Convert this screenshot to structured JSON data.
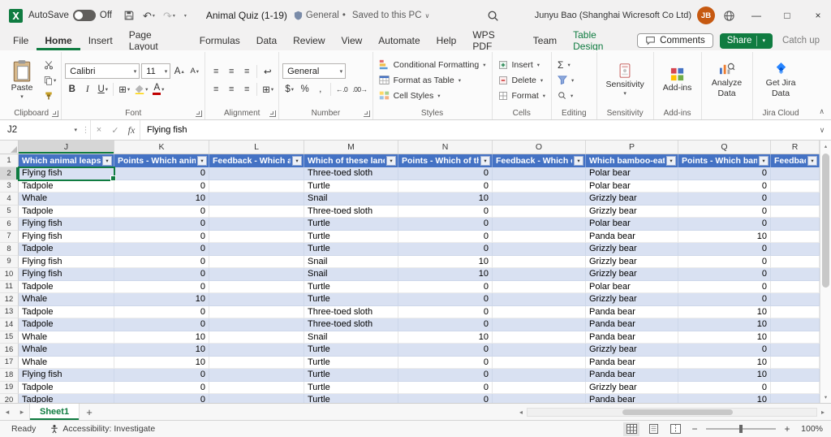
{
  "colors": {
    "accent": "#107C41",
    "table_header_fill": "#4472C4",
    "band_fill": "#D9E1F2",
    "selection_border": "#107C41",
    "avatar_fill": "#C65911",
    "jira_blue": "#2684FF"
  },
  "glyphs": {
    "dropdown": "▾",
    "undo": "↶",
    "redo": "↷",
    "bold": "B",
    "italic": "I",
    "underline": "U",
    "letter_a": "A",
    "up_tri": "▴",
    "down_tri": "▾",
    "sum": "Σ",
    "dollar": "$",
    "percent": "%",
    "comma": ",",
    "borders": "⊞",
    "merge": "⊞",
    "minimize": "—",
    "maximize": "□",
    "close": "×",
    "cancel": "×",
    "check": "✓",
    "fx": "fx",
    "more_vertical": "⋮",
    "chevron_up": "∧",
    "chevron_down": "∨",
    "tri_left": "◂",
    "tri_right": "▸",
    "plus": "+",
    "bullet": "•",
    "align_lines": "≡",
    "wrap": "↩",
    "increase_decimal": "←.0",
    "decrease_decimal": ".00→",
    "minus": "−"
  },
  "title_bar": {
    "autosave_label": "AutoSave",
    "autosave_state": "Off",
    "doc_title": "Animal Quiz (1-19)",
    "sensitivity_label": "General",
    "saved_status": "Saved to this PC",
    "user_name": "Junyu Bao (Shanghai Wicresoft Co Ltd)",
    "avatar_initials": "JB"
  },
  "tabs": {
    "items": [
      "File",
      "Home",
      "Insert",
      "Page Layout",
      "Formulas",
      "Data",
      "Review",
      "View",
      "Automate",
      "Help",
      "WPS PDF",
      "Team",
      "Table Design"
    ],
    "active": "Home",
    "contextual": "Table Design",
    "comments_label": "Comments",
    "share_label": "Share",
    "catch_up_label": "Catch up"
  },
  "ribbon": {
    "paste_label": "Paste",
    "font_name": "Calibri",
    "font_size": "11",
    "number_format": "General",
    "conditional_formatting_label": "Conditional Formatting",
    "format_as_table_label": "Format as Table",
    "cell_styles_label": "Cell Styles",
    "insert_label": "Insert",
    "delete_label": "Delete",
    "format_label": "Format",
    "sensitivity_label": "Sensitivity",
    "addins_label": "Add-ins",
    "analyze_data_label": "Analyze Data",
    "get_jira_label": "Get Jira Data",
    "group_labels": {
      "clipboard": "Clipboard",
      "font": "Font",
      "alignment": "Alignment",
      "number": "Number",
      "styles": "Styles",
      "cells": "Cells",
      "editing": "Editing",
      "sensitivity": "Sensitivity",
      "addins": "Add-ins",
      "jira": "Jira Cloud"
    }
  },
  "formula_bar": {
    "name_box": "J2",
    "value": "Flying fish"
  },
  "sheet": {
    "selected_cell": "J2",
    "active_column": "J",
    "active_row": 2,
    "column_letters": [
      "J",
      "K",
      "L",
      "M",
      "N",
      "O",
      "P",
      "Q",
      "R"
    ],
    "header_row": [
      "Which animal leaps o",
      "Points - Which anima",
      "Feedback - Which an",
      "Which of these land",
      "Points - Which of the",
      "Feedback - Which of",
      "Which bamboo-eatin",
      "Points - Which bamb",
      "Feedback"
    ],
    "rows": [
      {
        "n": 2,
        "cells": [
          "Flying fish",
          "0",
          "",
          "Three-toed sloth",
          "0",
          "",
          "Polar bear",
          "0",
          ""
        ]
      },
      {
        "n": 3,
        "cells": [
          "Tadpole",
          "0",
          "",
          "Turtle",
          "0",
          "",
          "Polar bear",
          "0",
          ""
        ]
      },
      {
        "n": 4,
        "cells": [
          "Whale",
          "10",
          "",
          "Snail",
          "10",
          "",
          "Grizzly bear",
          "0",
          ""
        ]
      },
      {
        "n": 5,
        "cells": [
          "Tadpole",
          "0",
          "",
          "Three-toed sloth",
          "0",
          "",
          "Grizzly bear",
          "0",
          ""
        ]
      },
      {
        "n": 6,
        "cells": [
          "Flying fish",
          "0",
          "",
          "Turtle",
          "0",
          "",
          "Polar bear",
          "0",
          ""
        ]
      },
      {
        "n": 7,
        "cells": [
          "Flying fish",
          "0",
          "",
          "Turtle",
          "0",
          "",
          "Panda bear",
          "10",
          ""
        ]
      },
      {
        "n": 8,
        "cells": [
          "Tadpole",
          "0",
          "",
          "Turtle",
          "0",
          "",
          "Grizzly bear",
          "0",
          ""
        ]
      },
      {
        "n": 9,
        "cells": [
          "Flying fish",
          "0",
          "",
          "Snail",
          "10",
          "",
          "Grizzly bear",
          "0",
          ""
        ]
      },
      {
        "n": 10,
        "cells": [
          "Flying fish",
          "0",
          "",
          "Snail",
          "10",
          "",
          "Grizzly bear",
          "0",
          ""
        ]
      },
      {
        "n": 11,
        "cells": [
          "Tadpole",
          "0",
          "",
          "Turtle",
          "0",
          "",
          "Polar bear",
          "0",
          ""
        ]
      },
      {
        "n": 12,
        "cells": [
          "Whale",
          "10",
          "",
          "Turtle",
          "0",
          "",
          "Grizzly bear",
          "0",
          ""
        ]
      },
      {
        "n": 13,
        "cells": [
          "Tadpole",
          "0",
          "",
          "Three-toed sloth",
          "0",
          "",
          "Panda bear",
          "10",
          ""
        ]
      },
      {
        "n": 14,
        "cells": [
          "Tadpole",
          "0",
          "",
          "Three-toed sloth",
          "0",
          "",
          "Panda bear",
          "10",
          ""
        ]
      },
      {
        "n": 15,
        "cells": [
          "Whale",
          "10",
          "",
          "Snail",
          "10",
          "",
          "Panda bear",
          "10",
          ""
        ]
      },
      {
        "n": 16,
        "cells": [
          "Whale",
          "10",
          "",
          "Turtle",
          "0",
          "",
          "Grizzly bear",
          "0",
          ""
        ]
      },
      {
        "n": 17,
        "cells": [
          "Whale",
          "10",
          "",
          "Turtle",
          "0",
          "",
          "Panda bear",
          "10",
          ""
        ]
      },
      {
        "n": 18,
        "cells": [
          "Flying fish",
          "0",
          "",
          "Turtle",
          "0",
          "",
          "Panda bear",
          "10",
          ""
        ]
      },
      {
        "n": 19,
        "cells": [
          "Tadpole",
          "0",
          "",
          "Turtle",
          "0",
          "",
          "Grizzly bear",
          "0",
          ""
        ]
      },
      {
        "n": 20,
        "cells": [
          "Tadpole",
          "0",
          "",
          "Turtle",
          "0",
          "",
          "Panda bear",
          "10",
          ""
        ]
      }
    ]
  },
  "sheet_tabs": {
    "active": "Sheet1"
  },
  "status_bar": {
    "mode": "Ready",
    "accessibility": "Accessibility: Investigate",
    "zoom": "100%"
  }
}
